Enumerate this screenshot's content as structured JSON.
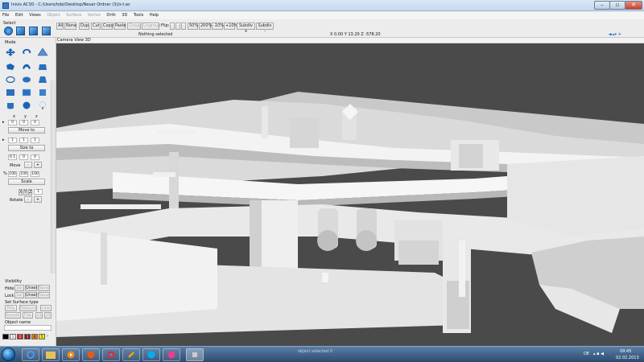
{
  "window": {
    "title": "Inivis AC3D - C:/Users/tobi/Desktop/Neuer Ordner (3)/s-t.ac"
  },
  "menu": {
    "items": [
      {
        "label": "File",
        "enabled": true
      },
      {
        "label": "Edit",
        "enabled": true
      },
      {
        "label": "Views",
        "enabled": true
      },
      {
        "label": "Object",
        "enabled": false
      },
      {
        "label": "Surface",
        "enabled": false
      },
      {
        "label": "Vertex",
        "enabled": false
      },
      {
        "label": "Orth",
        "enabled": true
      },
      {
        "label": "3D",
        "enabled": true
      },
      {
        "label": "Tools",
        "enabled": true
      },
      {
        "label": "Help",
        "enabled": true
      }
    ]
  },
  "toolbar": {
    "select_label": "Select",
    "all": "All",
    "none": "None",
    "dup": "Dup",
    "cut": "Cut",
    "copy": "Copy",
    "paste": "Paste",
    "group": "Group",
    "ungroup": "Ungroup",
    "flip_label": "Flip:",
    "zoom": [
      "50%",
      "200%",
      "-10%",
      "+10%"
    ],
    "subdiv_plus": "Subdiv +",
    "subdiv_minus": "Subdiv -",
    "status": "Nothing selected",
    "coords": "X 0.00 Y 13.20 Z -578.20"
  },
  "left": {
    "mode_label": "Mode",
    "axis": [
      "x",
      "y",
      "z"
    ],
    "pos_values": [
      "0",
      "0",
      "0"
    ],
    "move_to": "Move to",
    "size_values": [
      "1",
      "1",
      "1"
    ],
    "size_to": "Size to",
    "move_values": [
      "0.1",
      "0",
      "0"
    ],
    "move": "Move",
    "scale_values": [
      "100",
      "100",
      "100"
    ],
    "scale_pct": "%",
    "scale": "Scale",
    "rotate_axes": [
      "X",
      "Y",
      "Z"
    ],
    "rotate_value": "1",
    "rotate": "Rotate",
    "visibility": "Visibility",
    "hide": "Hide:",
    "lock": "Lock:",
    "sel": "Sel",
    "unsel": "Unsel",
    "none": "None",
    "surface_type": "Set Surface type",
    "poly": "Poly",
    "polyline": "PolyLine",
    "line": "Line",
    "smooth": "Smooth",
    "flat": "Flat",
    "one_s": "1S",
    "two_s": "2S",
    "object_name": "Object name",
    "palette": [
      "1",
      "2",
      "3",
      "4",
      "5"
    ]
  },
  "viewport": {
    "label": "Camera View 3D"
  },
  "taskbar": {
    "locale": "DE",
    "time": "09:45",
    "date": "02.02.2013",
    "hint": "object selected 0"
  },
  "colors": {
    "accent": "#1c6bb5",
    "viewport_bg": "#4a4a4a",
    "model": "#e8e8e8"
  }
}
